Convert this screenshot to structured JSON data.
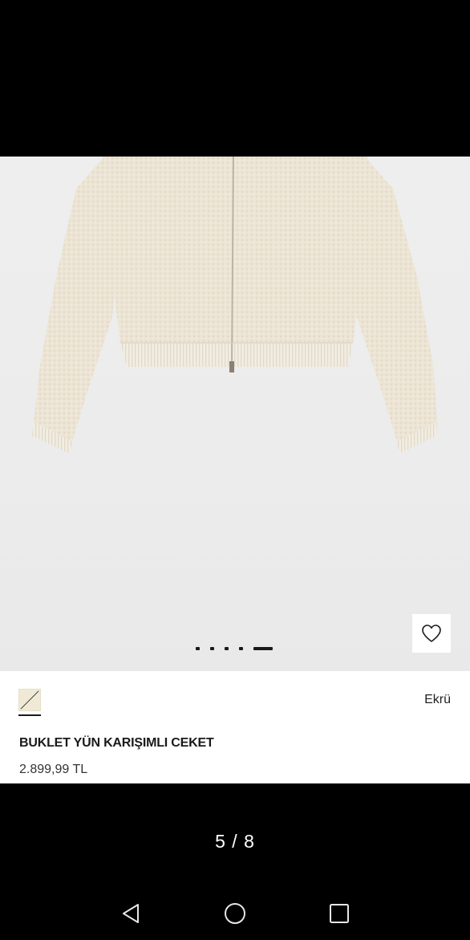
{
  "product": {
    "color_name": "Ekrü",
    "title": "BUKLET YÜN KARIŞIMLI CEKET",
    "price": "2.899,99 TL",
    "swatch_color": "#efe9d6"
  },
  "gallery": {
    "counter": "5 / 8",
    "current": 5,
    "total": 8,
    "indicator_dots": 5,
    "active_dot": 5
  },
  "icons": {
    "wishlist": "heart-icon",
    "nav_back": "back-triangle-icon",
    "nav_home": "home-circle-icon",
    "nav_recent": "recents-square-icon"
  },
  "colors": {
    "background": "#000000",
    "photo_background": "#ececec",
    "garment": "#ede5d6",
    "text": "#1a1a1a"
  }
}
